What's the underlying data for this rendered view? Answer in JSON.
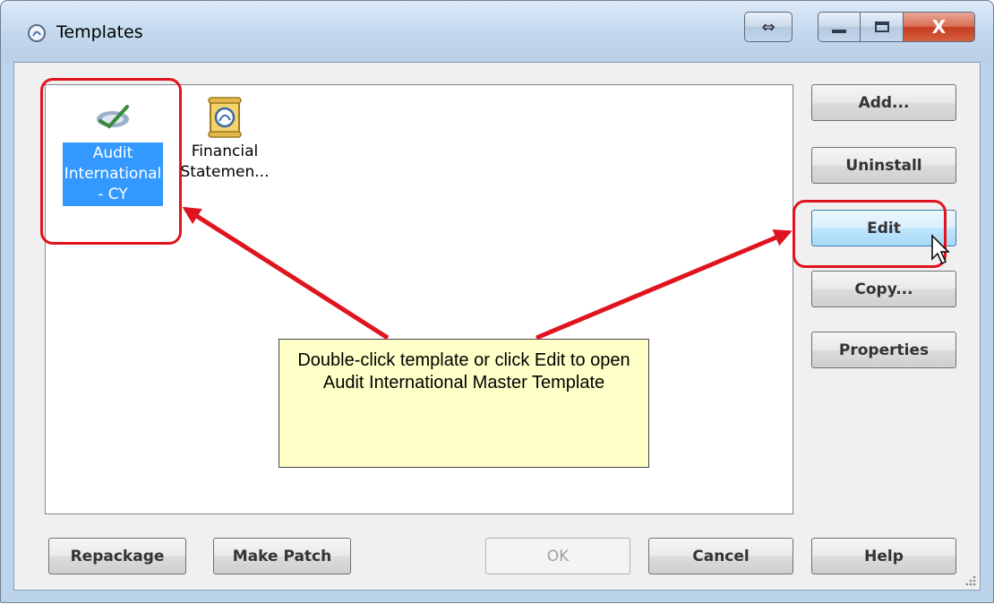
{
  "window": {
    "title": "Templates",
    "app_icon": "caseware-logo-icon",
    "titlebar_buttons": {
      "resize": "⇔",
      "minimize": "—",
      "maximize": "□",
      "close": "X"
    }
  },
  "templates": [
    {
      "label": "Audit\nInternational\n- CY",
      "icon": "checkmark-pen-icon",
      "selected": true
    },
    {
      "label": "Financial\nStatemen...",
      "icon": "scroll-logo-icon",
      "selected": false
    }
  ],
  "side_buttons": {
    "add": "Add...",
    "uninstall": "Uninstall",
    "edit": "Edit",
    "copy": "Copy...",
    "properties": "Properties"
  },
  "bottom_buttons": {
    "repackage": "Repackage",
    "make_patch": "Make Patch",
    "ok": "OK",
    "cancel": "Cancel",
    "help": "Help"
  },
  "annotation": {
    "text": "Double-click template or click Edit to open Audit International Master Template"
  },
  "colors": {
    "selection": "#3399ff",
    "highlight": "#e0141e",
    "callout": "#ffffc8"
  }
}
